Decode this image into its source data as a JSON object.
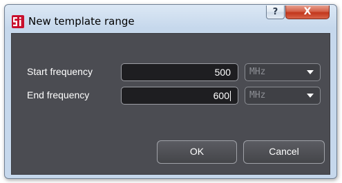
{
  "window": {
    "title": "New template range",
    "help_glyph": "?",
    "close_glyph": "X"
  },
  "form": {
    "start": {
      "label": "Start frequency",
      "value": "500",
      "unit": "MHz"
    },
    "end": {
      "label": "End frequency",
      "value": "600",
      "unit": "MHz"
    }
  },
  "buttons": {
    "ok": "OK",
    "cancel": "Cancel"
  },
  "icons": {
    "app_logo": "si-logo-icon",
    "help": "help-icon",
    "close": "close-icon",
    "dropdown": "chevron-down-icon"
  },
  "colors": {
    "logo_red": "#c8102e",
    "panel_bg": "#4b4c52",
    "close_red": "#c2361c"
  }
}
